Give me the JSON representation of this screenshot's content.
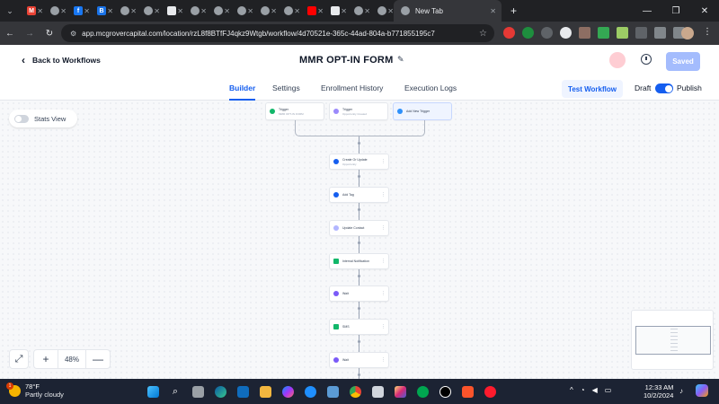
{
  "browser": {
    "active_tab_title": "New Tab",
    "url": "app.mcgrovercapital.com/location/rzL8f8BTfFJ4qkz9Wtgb/workflow/4d70521e-365c-44ad-804a-b771855195c7",
    "tabs": [
      {
        "icon": "gmail-icon",
        "color": "#ea4335",
        "glyph": "M"
      },
      {
        "icon": "globe-icon",
        "color": "#9aa0a6",
        "glyph": ""
      },
      {
        "icon": "facebook-icon",
        "color": "#1877f2",
        "glyph": "f"
      },
      {
        "icon": "bing-icon",
        "color": "#1a73e8",
        "glyph": "B"
      },
      {
        "icon": "globe-icon",
        "color": "#9aa0a6",
        "glyph": ""
      },
      {
        "icon": "globe-icon",
        "color": "#9aa0a6",
        "glyph": ""
      },
      {
        "icon": "app-icon",
        "color": "#e8eaed",
        "glyph": ""
      },
      {
        "icon": "globe-icon",
        "color": "#9aa0a6",
        "glyph": ""
      },
      {
        "icon": "globe-icon",
        "color": "#9aa0a6",
        "glyph": ""
      },
      {
        "icon": "globe-icon",
        "color": "#9aa0a6",
        "glyph": ""
      },
      {
        "icon": "globe-icon",
        "color": "#9aa0a6",
        "glyph": ""
      },
      {
        "icon": "globe-icon",
        "color": "#9aa0a6",
        "glyph": ""
      },
      {
        "icon": "youtube-icon",
        "color": "#ff0000",
        "glyph": ""
      },
      {
        "icon": "page-icon",
        "color": "#e8eaed",
        "glyph": ""
      },
      {
        "icon": "globe-icon",
        "color": "#9aa0a6",
        "glyph": ""
      },
      {
        "icon": "globe-icon",
        "color": "#9aa0a6",
        "glyph": ""
      }
    ]
  },
  "header": {
    "back_label": "Back to Workflows",
    "title": "MMR OPT-IN FORM",
    "saved_label": "Saved"
  },
  "subnav": {
    "tabs": [
      "Builder",
      "Settings",
      "Enrollment History",
      "Execution Logs"
    ],
    "active": "Builder",
    "test_label": "Test Workflow",
    "draft_label": "Draft",
    "publish_label": "Publish"
  },
  "canvas": {
    "stats_label": "Stats View",
    "zoom": "48%",
    "triggers": [
      {
        "title": "Trigger",
        "subtitle": "MMR OPT-IN FORM",
        "color": "#12b76a"
      },
      {
        "title": "Trigger",
        "subtitle": "Opportunity Created",
        "color": "#9b8afb"
      },
      {
        "title": "Add New Trigger",
        "subtitle": "",
        "color": "#2e90fa"
      }
    ],
    "actions": [
      {
        "title": "Create Or Update",
        "subtitle": "Opportunity",
        "color": "#155eef"
      },
      {
        "title": "Add Tag",
        "subtitle": "",
        "color": "#155eef"
      },
      {
        "title": "Update Contact",
        "subtitle": "",
        "color": "#b2b6ff"
      },
      {
        "title": "Internal Notification",
        "subtitle": "",
        "color": "#12b76a"
      },
      {
        "title": "Wait",
        "subtitle": "",
        "color": "#7a5af8"
      },
      {
        "title": "SMS",
        "subtitle": "",
        "color": "#12b76a"
      },
      {
        "title": "Wait",
        "subtitle": "",
        "color": "#7a5af8"
      }
    ]
  },
  "taskbar": {
    "temperature": "78°F",
    "condition": "Partly cloudy",
    "weather_badge": "1",
    "time": "12:33 AM",
    "date": "10/2/2024"
  }
}
